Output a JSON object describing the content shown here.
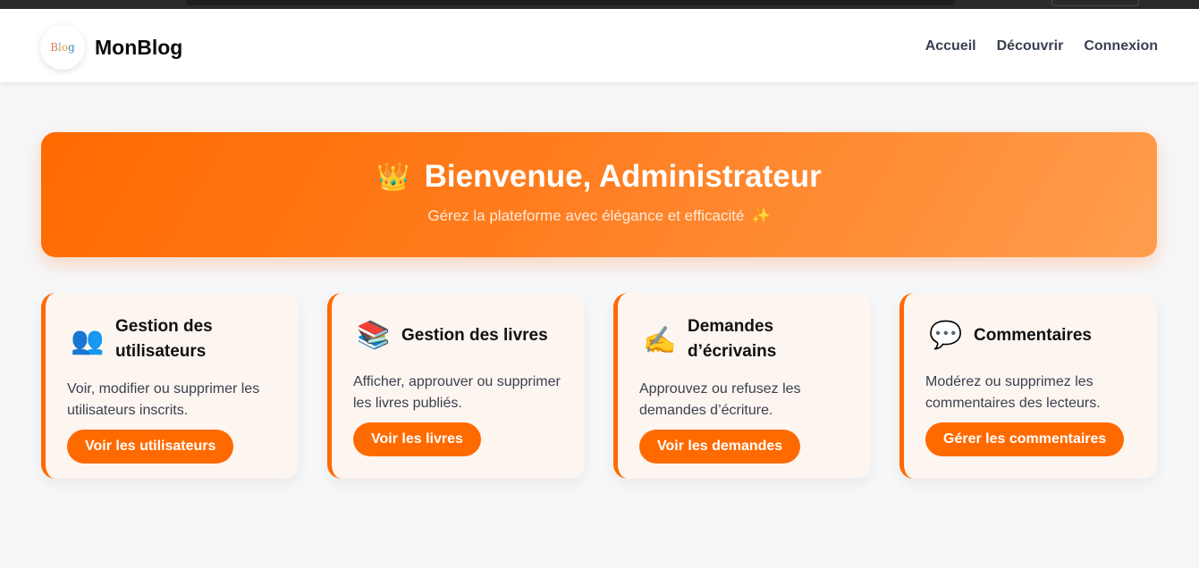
{
  "header": {
    "logo_text": "Blog",
    "brand": "MonBlog",
    "nav": [
      "Accueil",
      "Découvrir",
      "Connexion"
    ]
  },
  "hero": {
    "icon": "crown-icon",
    "title": "Bienvenue, Administrateur",
    "subtitle": "Gérez la plateforme avec élégance et efficacité",
    "subtitle_icon": "sparkles-icon"
  },
  "cards": [
    {
      "icon": "users-icon",
      "title": "Gestion des utilisateurs",
      "description": "Voir, modifier ou supprimer les utilisateurs inscrits.",
      "button": "Voir les utilisateurs"
    },
    {
      "icon": "books-icon",
      "title": "Gestion des livres",
      "description": "Afficher, approuver ou supprimer les livres publiés.",
      "button": "Voir les livres"
    },
    {
      "icon": "writing-hand-icon",
      "title": "Demandes d’écrivains",
      "description": "Approuvez ou refusez les demandes d’écriture.",
      "button": "Voir les demandes"
    },
    {
      "icon": "speech-bubble-icon",
      "title": "Commentaires",
      "description": "Modérez ou supprimez les commentaires des lecteurs.",
      "button": "Gérer les commentaires"
    }
  ],
  "colors": {
    "accent": "#ff6a00",
    "card_bg": "#fdf5f0",
    "page_bg": "#f6f7f9"
  }
}
